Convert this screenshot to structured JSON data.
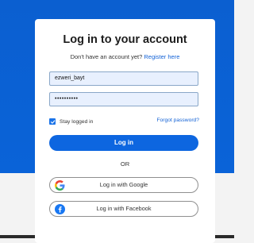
{
  "login": {
    "title": "Log in to your account",
    "signup_prompt": "Don't have an account yet?",
    "signup_link": "Register here",
    "username_value": "ezweri_bayt",
    "password_masked": "••••••••••",
    "stay_logged_in_label": "Stay logged in",
    "stay_logged_in_checked": true,
    "forgot_password": "Forgot password?",
    "login_button": "Log in",
    "divider_text": "OR",
    "google_button": "Log in with Google",
    "facebook_button": "Log in with Facebook"
  },
  "colors": {
    "primary_blue": "#0d66e0",
    "link_blue": "#1463d6",
    "input_bg": "#e8f0fe",
    "background_blue": "#0b5fd0",
    "background_gray": "#f3f3f3",
    "facebook_blue": "#1877f2"
  },
  "icons": {
    "google": "google-logo-icon",
    "facebook": "facebook-logo-icon",
    "checkbox": "checkmark-icon"
  }
}
